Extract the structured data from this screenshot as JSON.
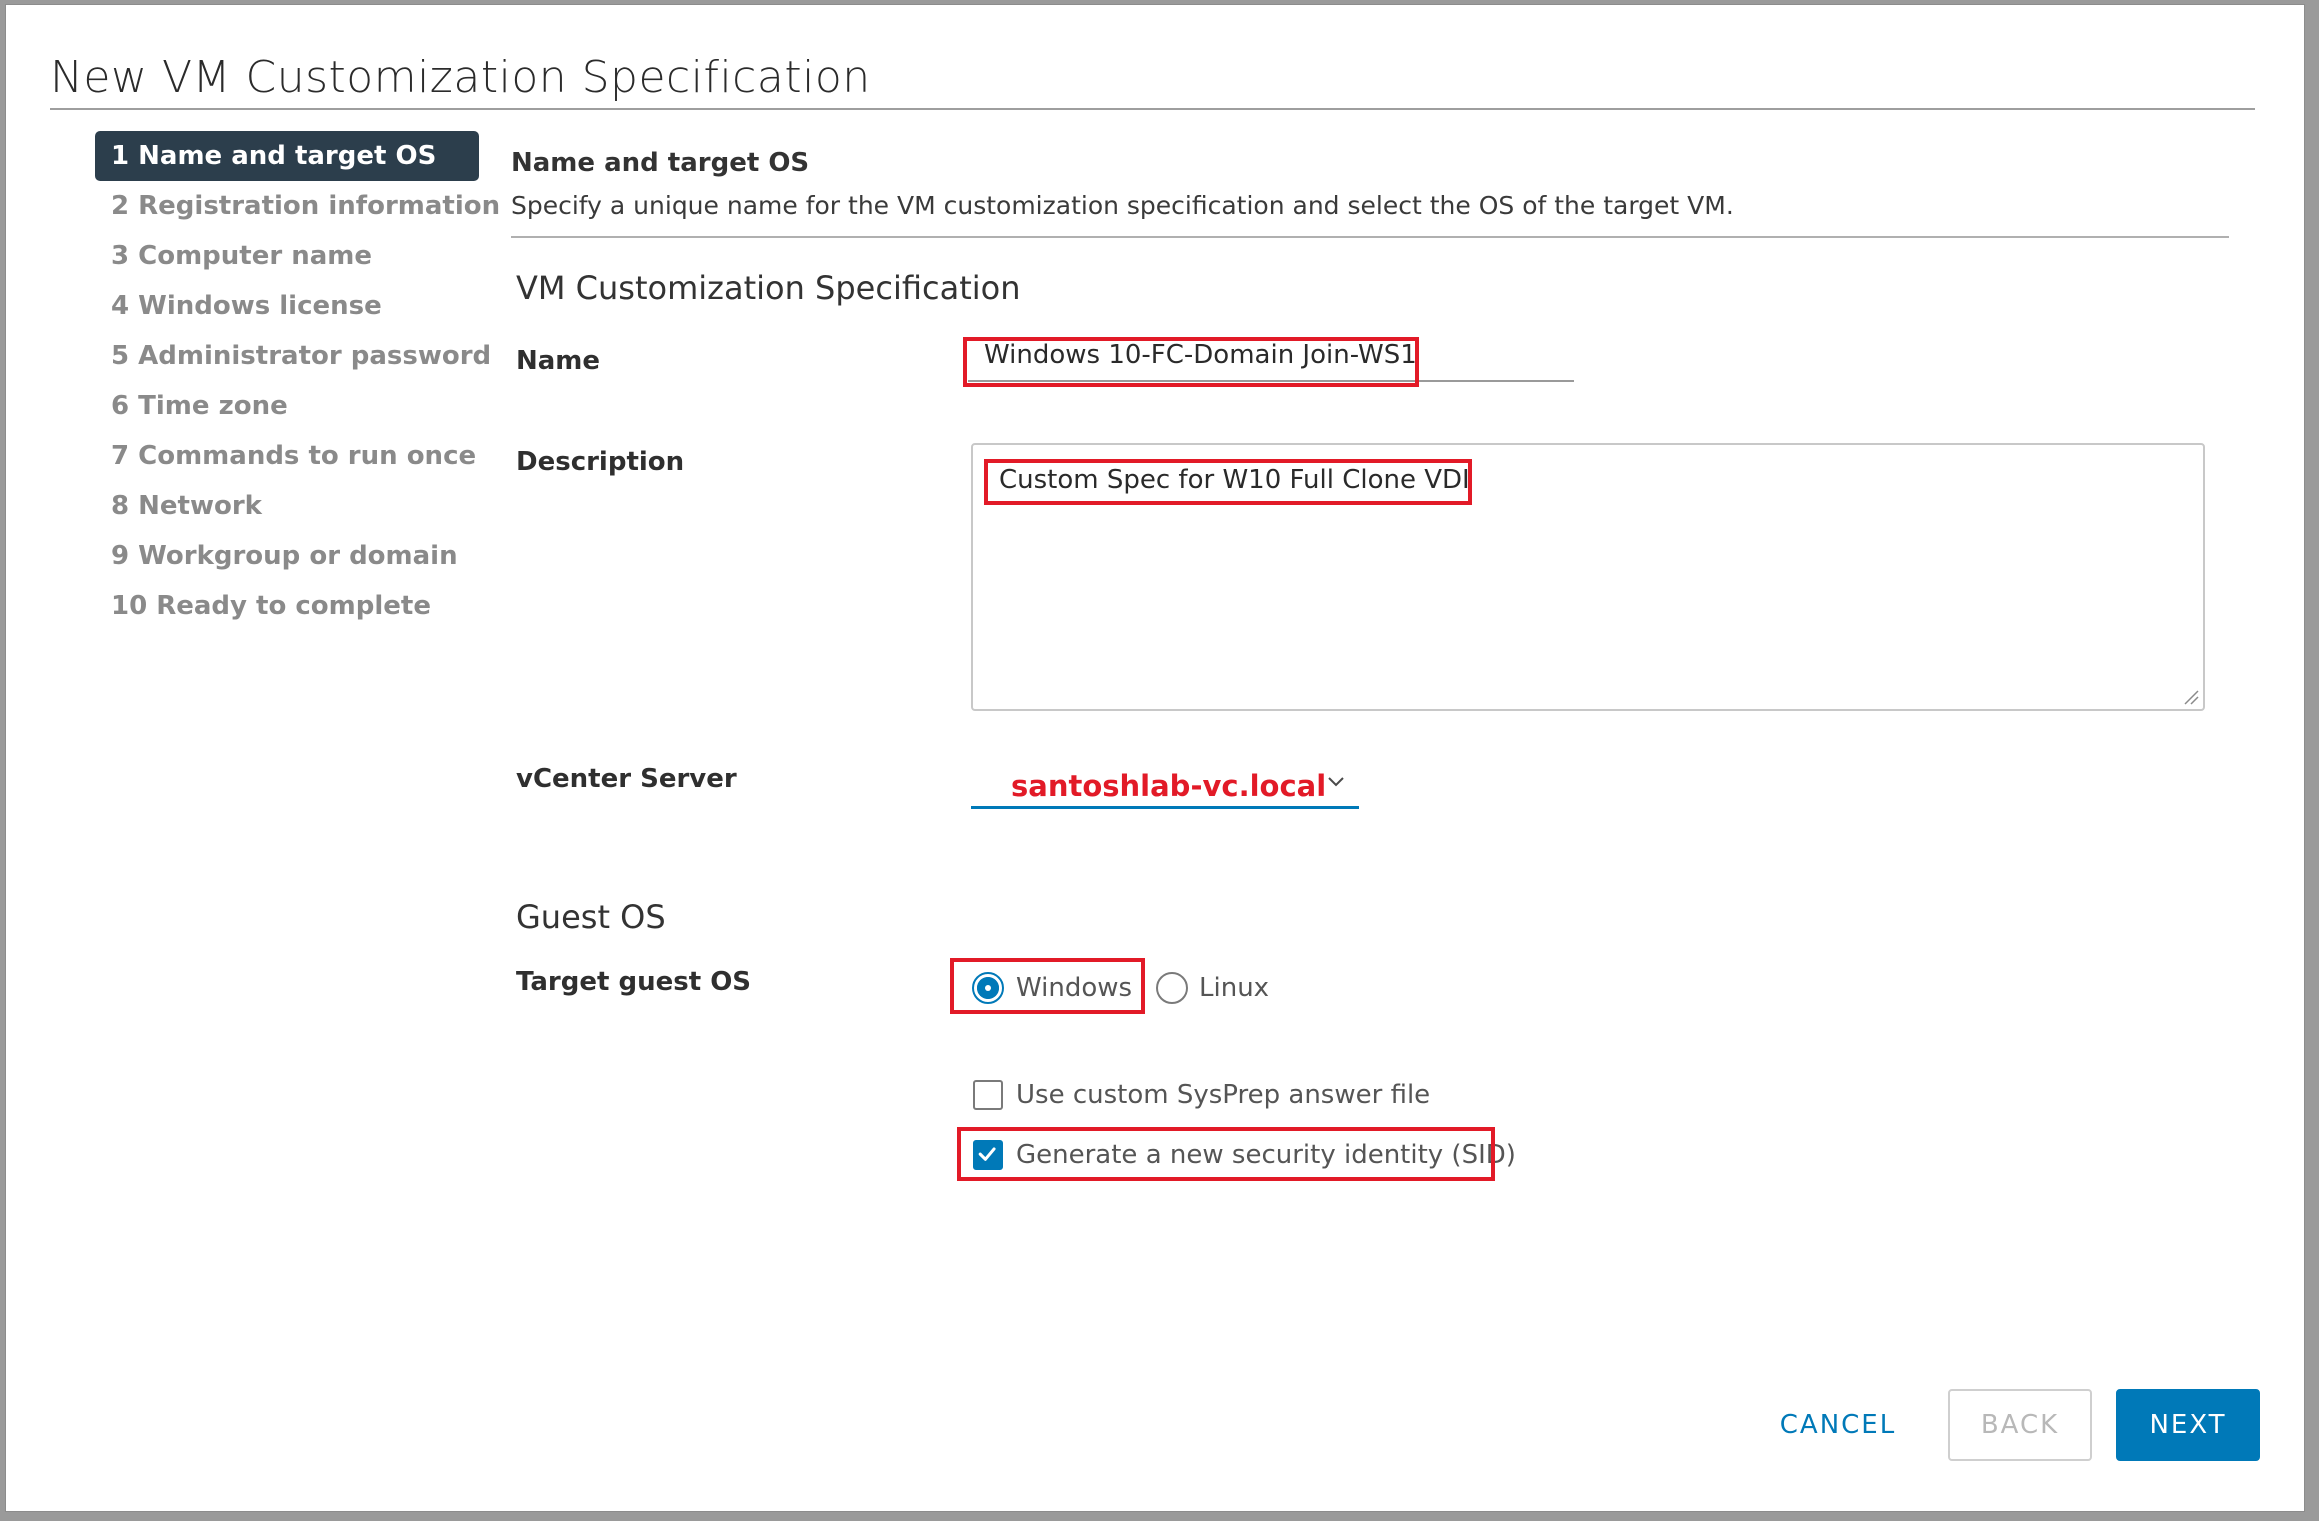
{
  "dialog": {
    "title": "New VM Customization Specification"
  },
  "steps": [
    "1 Name and target OS",
    "2 Registration information",
    "3 Computer name",
    "4 Windows license",
    "5 Administrator password",
    "6 Time zone",
    "7 Commands to run once",
    "8 Network",
    "9 Workgroup or domain",
    "10 Ready to complete"
  ],
  "active_step": 0,
  "section": {
    "title": "Name and target OS",
    "subtitle": "Specify a unique name for the VM customization specification and select the OS of the target VM."
  },
  "spec": {
    "heading": "VM Customization Specification",
    "name_label": "Name",
    "name_value": "Windows 10-FC-Domain Join-WS1",
    "description_label": "Description",
    "description_value": "Custom Spec for W10 Full Clone VDI",
    "vcenter_label": "vCenter Server",
    "vcenter_value": "santoshlab-vc.local"
  },
  "guest_os": {
    "heading": "Guest OS",
    "target_label": "Target guest OS",
    "options": [
      {
        "label": "Windows",
        "selected": true
      },
      {
        "label": "Linux",
        "selected": false
      }
    ],
    "use_sysprep_label": "Use custom SysPrep answer file",
    "use_sysprep_checked": false,
    "generate_sid_label": "Generate a new security identity (SID)",
    "generate_sid_checked": true
  },
  "buttons": {
    "cancel": "CANCEL",
    "back": "BACK",
    "next": "NEXT"
  },
  "colors": {
    "accent": "#0079b8",
    "highlight": "#e21a27",
    "nav_active": "#2c3e4c"
  }
}
